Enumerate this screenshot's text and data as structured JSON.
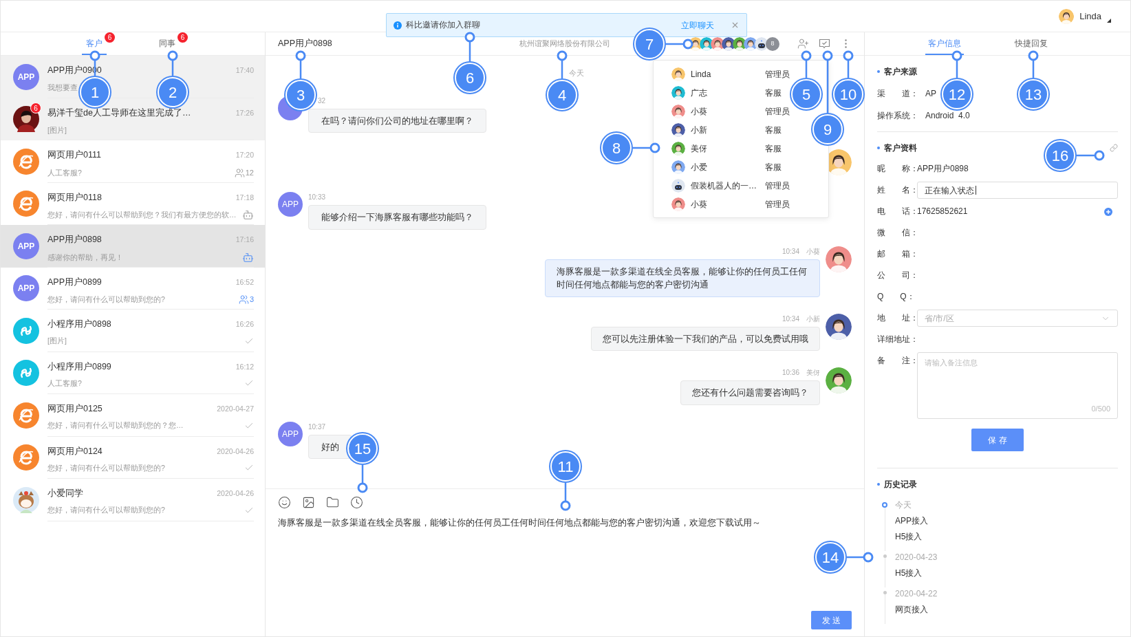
{
  "top_bar": {
    "user": "Linda"
  },
  "notice": {
    "text": "科比邀请你加入群聊",
    "action": "立即聊天"
  },
  "left_tabs": [
    {
      "label": "客户",
      "badge": "6",
      "selected": true
    },
    {
      "label": "同事",
      "badge": "6",
      "selected": false
    }
  ],
  "conversations": [
    {
      "avatar": {
        "kind": "app",
        "text": "APP"
      },
      "name": "APP用户0900",
      "preview": "我想要查",
      "time": "17:40",
      "pinned": true,
      "selected": false
    },
    {
      "avatar": {
        "kind": "photo",
        "badge": "6"
      },
      "name": "易洋千玺de人工导师在这里完成了…",
      "preview": "[图片]",
      "time": "17:26",
      "pinned": true,
      "selected": false
    },
    {
      "avatar": {
        "kind": "web"
      },
      "name": "网页用户0111",
      "preview": "人工客服?",
      "time": "17:20",
      "pinned": false,
      "selected": false,
      "status": {
        "kind": "group",
        "count": "12",
        "active": false
      }
    },
    {
      "avatar": {
        "kind": "web"
      },
      "name": "网页用户0118",
      "preview": "您好，请问有什么可以帮助到您？我们有最方便您的软…",
      "time": "17:18",
      "pinned": false,
      "selected": false,
      "status": {
        "kind": "robot",
        "active": false
      }
    },
    {
      "avatar": {
        "kind": "app",
        "text": "APP"
      },
      "name": "APP用户0898",
      "preview": "感谢你的帮助，再见！",
      "time": "17:16",
      "pinned": false,
      "selected": true,
      "status": {
        "kind": "robot",
        "active": true
      }
    },
    {
      "avatar": {
        "kind": "app",
        "text": "APP"
      },
      "name": "APP用户0899",
      "preview": "您好，请问有什么可以帮助到您的?",
      "time": "16:52",
      "pinned": false,
      "selected": false,
      "status": {
        "kind": "group",
        "count": "3",
        "active": true
      }
    },
    {
      "avatar": {
        "kind": "mini"
      },
      "name": "小程序用户0898",
      "preview": "[图片]",
      "time": "16:26",
      "pinned": false,
      "selected": false,
      "status": {
        "kind": "read"
      }
    },
    {
      "avatar": {
        "kind": "mini"
      },
      "name": "小程序用户0899",
      "preview": "人工客服?",
      "time": "16:12",
      "pinned": false,
      "selected": false,
      "status": {
        "kind": "read"
      }
    },
    {
      "avatar": {
        "kind": "web"
      },
      "name": "网页用户0125",
      "preview": "您好，请问有什么可以帮助到您的？您…",
      "time": "2020-04-27",
      "pinned": false,
      "selected": false,
      "status": {
        "kind": "read"
      }
    },
    {
      "avatar": {
        "kind": "web"
      },
      "name": "网页用户0124",
      "preview": "您好，请问有什么可以帮助到您的?",
      "time": "2020-04-26",
      "pinned": false,
      "selected": false,
      "status": {
        "kind": "read"
      }
    },
    {
      "avatar": {
        "kind": "cartoon"
      },
      "name": "小爱同学",
      "preview": "您好，请问有什么可以帮助到您的?",
      "time": "2020-04-26",
      "pinned": false,
      "selected": false,
      "status": {
        "kind": "read"
      }
    }
  ],
  "chat": {
    "title": "APP用户0898",
    "company": "杭州谊聚网络股份有限公司",
    "member_count": "8",
    "date": "今天"
  },
  "members": [
    {
      "name": "Linda",
      "role": "管理员",
      "color": "#f8c56b",
      "kind": "person"
    },
    {
      "name": "广志",
      "role": "客服",
      "color": "#1fbcd2",
      "kind": "person"
    },
    {
      "name": "小葵",
      "role": "管理员",
      "color": "#ef8d8a",
      "kind": "person"
    },
    {
      "name": "小新",
      "role": "客服",
      "color": "#4d5fa8",
      "kind": "person"
    },
    {
      "name": "美伢",
      "role": "客服",
      "color": "#5bb042",
      "kind": "person"
    },
    {
      "name": "小爱",
      "role": "客服",
      "color": "#7fa9f0",
      "kind": "person"
    },
    {
      "name": "假装机器人的一…",
      "role": "管理员",
      "color": "#dfe6f0",
      "kind": "robot"
    },
    {
      "name": "小葵",
      "role": "管理员",
      "color": "#ef8d8a",
      "kind": "person"
    }
  ],
  "messages": [
    {
      "kind": "incoming",
      "time": "32",
      "text": "在吗？请问你们公司的地址在哪里啊？"
    },
    {
      "kind": "avatar_only",
      "color": "#f8c56b"
    },
    {
      "kind": "incoming",
      "avatar_text": "APP",
      "time": "10:33",
      "text": "能够介绍一下海豚客服有哪些功能吗？"
    },
    {
      "kind": "outgoing",
      "time": "10:34",
      "sender": "小葵",
      "color": "#ef8d8a",
      "highlighted": true,
      "text": "海豚客服是一款多渠道在线全员客服，能够让你的任何员工任何时间任何地点都能与您的客户密切沟通"
    },
    {
      "kind": "outgoing",
      "time": "10:34",
      "sender": "小新",
      "color": "#4d5fa8",
      "highlighted": false,
      "text": "您可以先注册体验一下我们的产品，可以免费试用哦"
    },
    {
      "kind": "outgoing",
      "time": "10:36",
      "sender": "美伢",
      "color": "#5bb042",
      "highlighted": false,
      "text": "您还有什么问题需要咨询吗？"
    },
    {
      "kind": "incoming",
      "avatar_text": "APP",
      "time": "10:37",
      "text": "好的"
    }
  ],
  "composer": {
    "value": "海豚客服是一款多渠道在线全员客服，能够让你的任何员工任何时间任何地点都能与您的客户密切沟通，欢迎您下载试用～",
    "send": "发 送"
  },
  "right_tabs": [
    {
      "label": "客户信息",
      "selected": true
    },
    {
      "label": "快捷回复",
      "selected": false
    }
  ],
  "source": {
    "title": "客户来源",
    "fields": [
      {
        "label": "渠　　道：",
        "value": "AP"
      },
      {
        "label": "操作系统：",
        "value": "Android  4.0"
      }
    ]
  },
  "profile": {
    "title": "客户资料",
    "fields": [
      {
        "label": "昵　　称：",
        "kind": "text",
        "value": "APP用户0898"
      },
      {
        "label": "姓　　名：",
        "kind": "input",
        "value": "正在输入状态"
      },
      {
        "label": "电　　话：",
        "kind": "phone",
        "value": "17625852621"
      },
      {
        "label": "微　　信：",
        "kind": "text"
      },
      {
        "label": "邮　　箱：",
        "kind": "text"
      },
      {
        "label": "公　　司：",
        "kind": "text"
      },
      {
        "label": "Q　　Q：",
        "kind": "text"
      },
      {
        "label": "地　　址：",
        "kind": "select",
        "placeholder": "省/市/区"
      },
      {
        "label": "详细地址：",
        "kind": "text"
      },
      {
        "label": "备　　注：",
        "kind": "textarea",
        "placeholder": "请输入备注信息",
        "counter": "0/500"
      }
    ],
    "save": "保 存"
  },
  "history": {
    "title": "历史记录",
    "entries": [
      {
        "date": "今天",
        "current": true,
        "items": [
          "APP接入",
          "H5接入"
        ]
      },
      {
        "date": "2020-04-23",
        "current": false,
        "items": [
          "H5接入"
        ]
      },
      {
        "date": "2020-04-22",
        "current": false,
        "items": [
          "网页接入"
        ]
      }
    ]
  },
  "callouts": [
    "1",
    "2",
    "3",
    "4",
    "5",
    "6",
    "7",
    "8",
    "9",
    "10",
    "11",
    "12",
    "13",
    "14",
    "15",
    "16"
  ]
}
